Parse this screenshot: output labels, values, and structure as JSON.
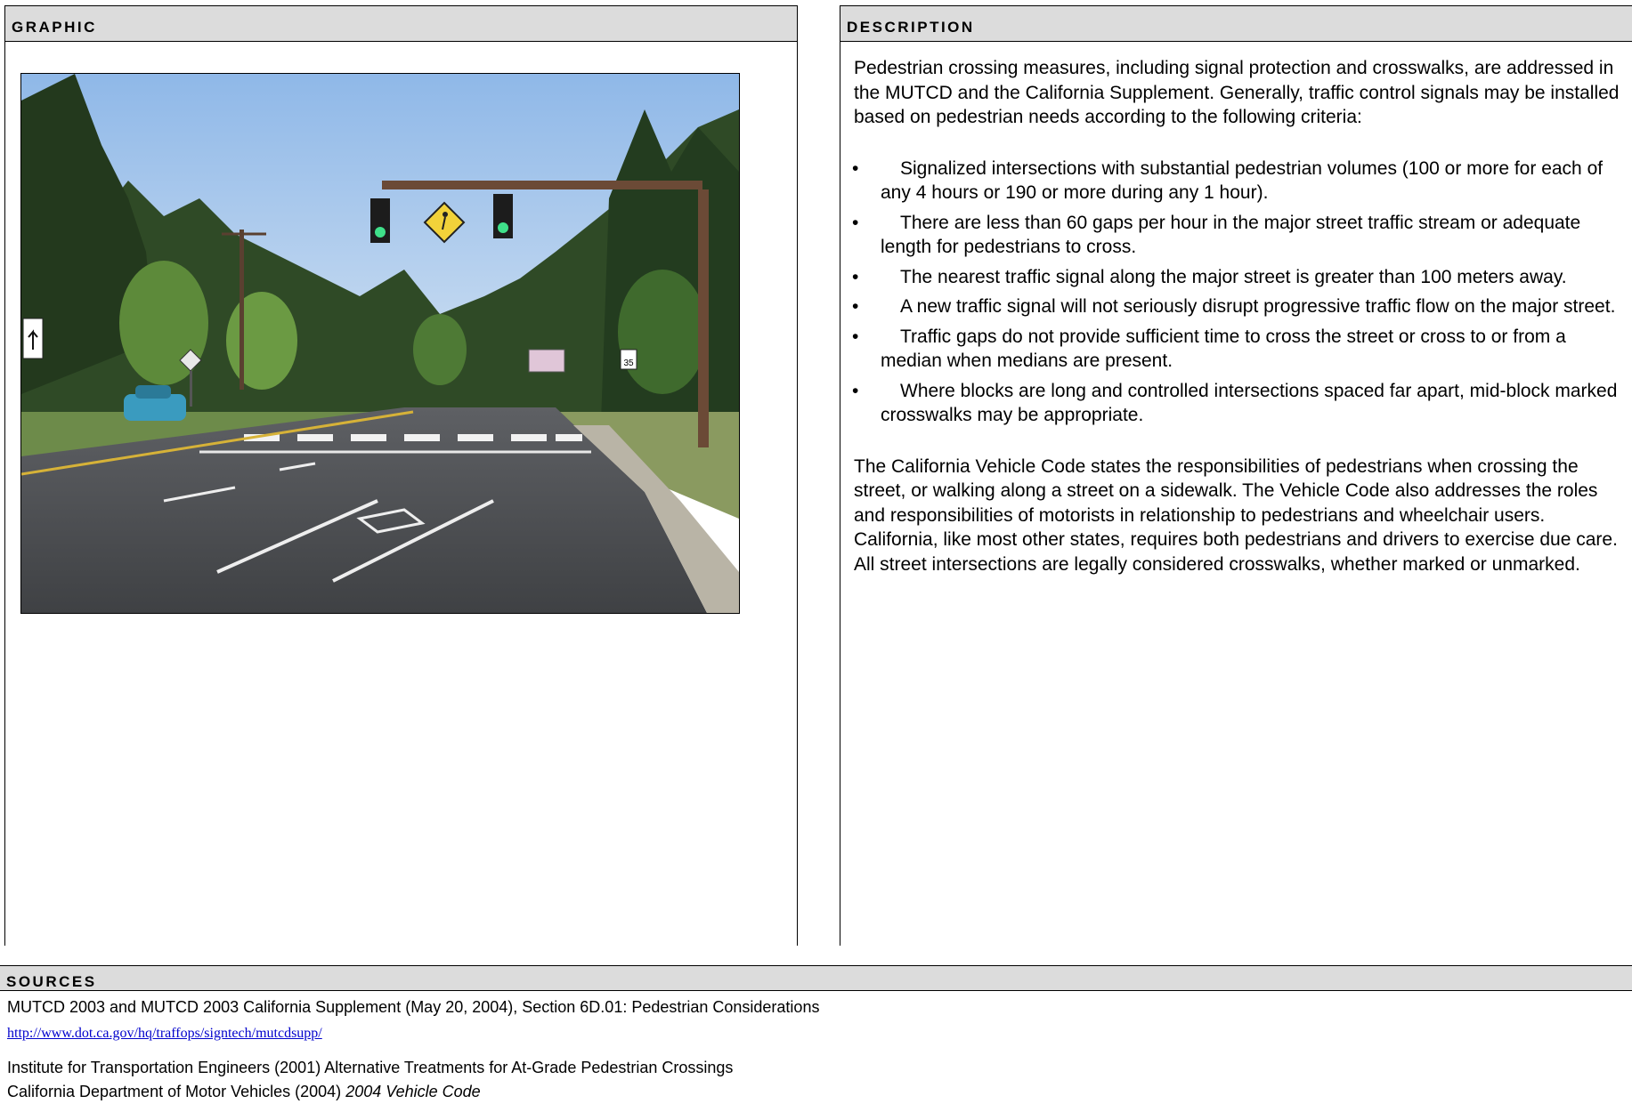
{
  "graphic": {
    "title": "Graphic"
  },
  "description": {
    "title": "Description",
    "intro": "Pedestrian crossing measures, including signal protection and crosswalks, are addressed in the MUTCD and the California Supplement.  Generally, traffic control signals may be installed based on pedestrian needs according to the following criteria:",
    "bullets": [
      "Signalized intersections with substantial pedestrian volumes (100 or more for each of any 4 hours or 190 or more during any 1 hour).",
      "There are less than 60 gaps per hour in the major street traffic stream or adequate length for pedestrians to cross.",
      "The nearest traffic signal along the major street is greater than 100 meters away.",
      "A new traffic signal will not seriously disrupt progressive traffic flow on the major street.",
      "Traffic gaps do not provide sufficient time to cross the street or cross to or from a median when medians are present.",
      "Where blocks are long and controlled intersections spaced far apart, mid-block marked crosswalks may be appropriate."
    ],
    "closing": "The California Vehicle Code states the responsibilities of pedestrians when crossing the street, or walking along a street on a sidewalk. The Vehicle Code also addresses the roles and responsibilities of motorists in relationship to pedestrians and wheelchair users. California, like most other states, requires both pedestrians and drivers to exercise due care. All street intersections are legally considered crosswalks, whether marked or unmarked."
  },
  "sources": {
    "title": "Sources",
    "line1": "MUTCD 2003 and MUTCD 2003 California Supplement (May 20, 2004), Section 6D.01:  Pedestrian Considerations",
    "link": "http://www.dot.ca.gov/hq/traffops/signtech/mutcdsupp/",
    "line2": "Institute for Transportation Engineers (2001)  Alternative Treatments for At-Grade Pedestrian Crossings",
    "line3_prefix": "California Department of Motor Vehicles (2004) ",
    "line3_title": "2004 Vehicle Code"
  },
  "photo": {
    "speed_sign": "35"
  }
}
